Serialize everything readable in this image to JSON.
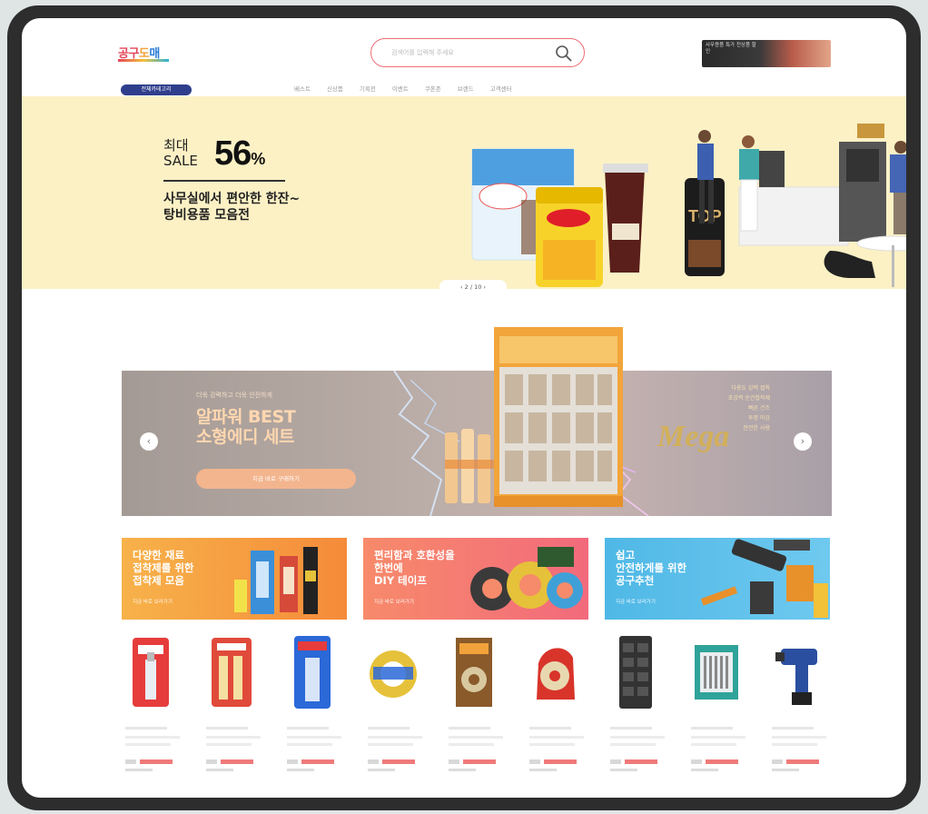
{
  "header": {
    "logo": [
      "공구",
      "도",
      "매"
    ],
    "search_placeholder": "검색어를 입력해 주세요",
    "top_ad_text": "사무용품 특가 전상품 할인"
  },
  "nav": {
    "category_button": "전체카테고리",
    "items": [
      "베스트",
      "신상품",
      "기획전",
      "이벤트",
      "쿠폰존",
      "브랜드",
      "고객센터"
    ]
  },
  "hero": {
    "label": "최대\nSALE",
    "percent": "56",
    "percent_unit": "%",
    "copy": "사무실에서 편안한 한잔~\n탕비용품 모음전",
    "pager": "2 / 10"
  },
  "promo": {
    "small_text": "더욱 강력하고 더욱 안전하게",
    "big_text": "알파워 BEST\n소형에디 세트",
    "cta": "지금 바로 구매하기",
    "right_lines": [
      "다용도 강력 접착",
      "초강력 순간접착제",
      "빠른 건조",
      "투명 마감",
      "안전한 사용"
    ],
    "deco_text": "Mega"
  },
  "categories": [
    {
      "title": "다양한 재료\n접착제를 위한\n접착제 모음",
      "sub": "지금 바로 보러가기",
      "color_from": "#f7b24a",
      "color_to": "#f58b3a"
    },
    {
      "title": "편리함과 호환성을\n한번에\nDIY 테이프",
      "sub": "지금 바로 보러가기",
      "color_from": "#f78a6a",
      "color_to": "#f26a7c"
    },
    {
      "title": "쉽고\n안전하게를 위한\n공구추천",
      "sub": "지금 바로 보러가기",
      "color_from": "#4fb8e6",
      "color_to": "#6fc9ef"
    }
  ],
  "products": [
    {
      "icon": "glue-tube-icon"
    },
    {
      "icon": "glue-twin-icon"
    },
    {
      "icon": "glue-blue-icon"
    },
    {
      "icon": "tape-roll-icon"
    },
    {
      "icon": "tape-pack-icon"
    },
    {
      "icon": "tape-dispenser-icon"
    },
    {
      "icon": "tool-case-icon"
    },
    {
      "icon": "bit-set-icon"
    },
    {
      "icon": "drill-icon"
    }
  ]
}
